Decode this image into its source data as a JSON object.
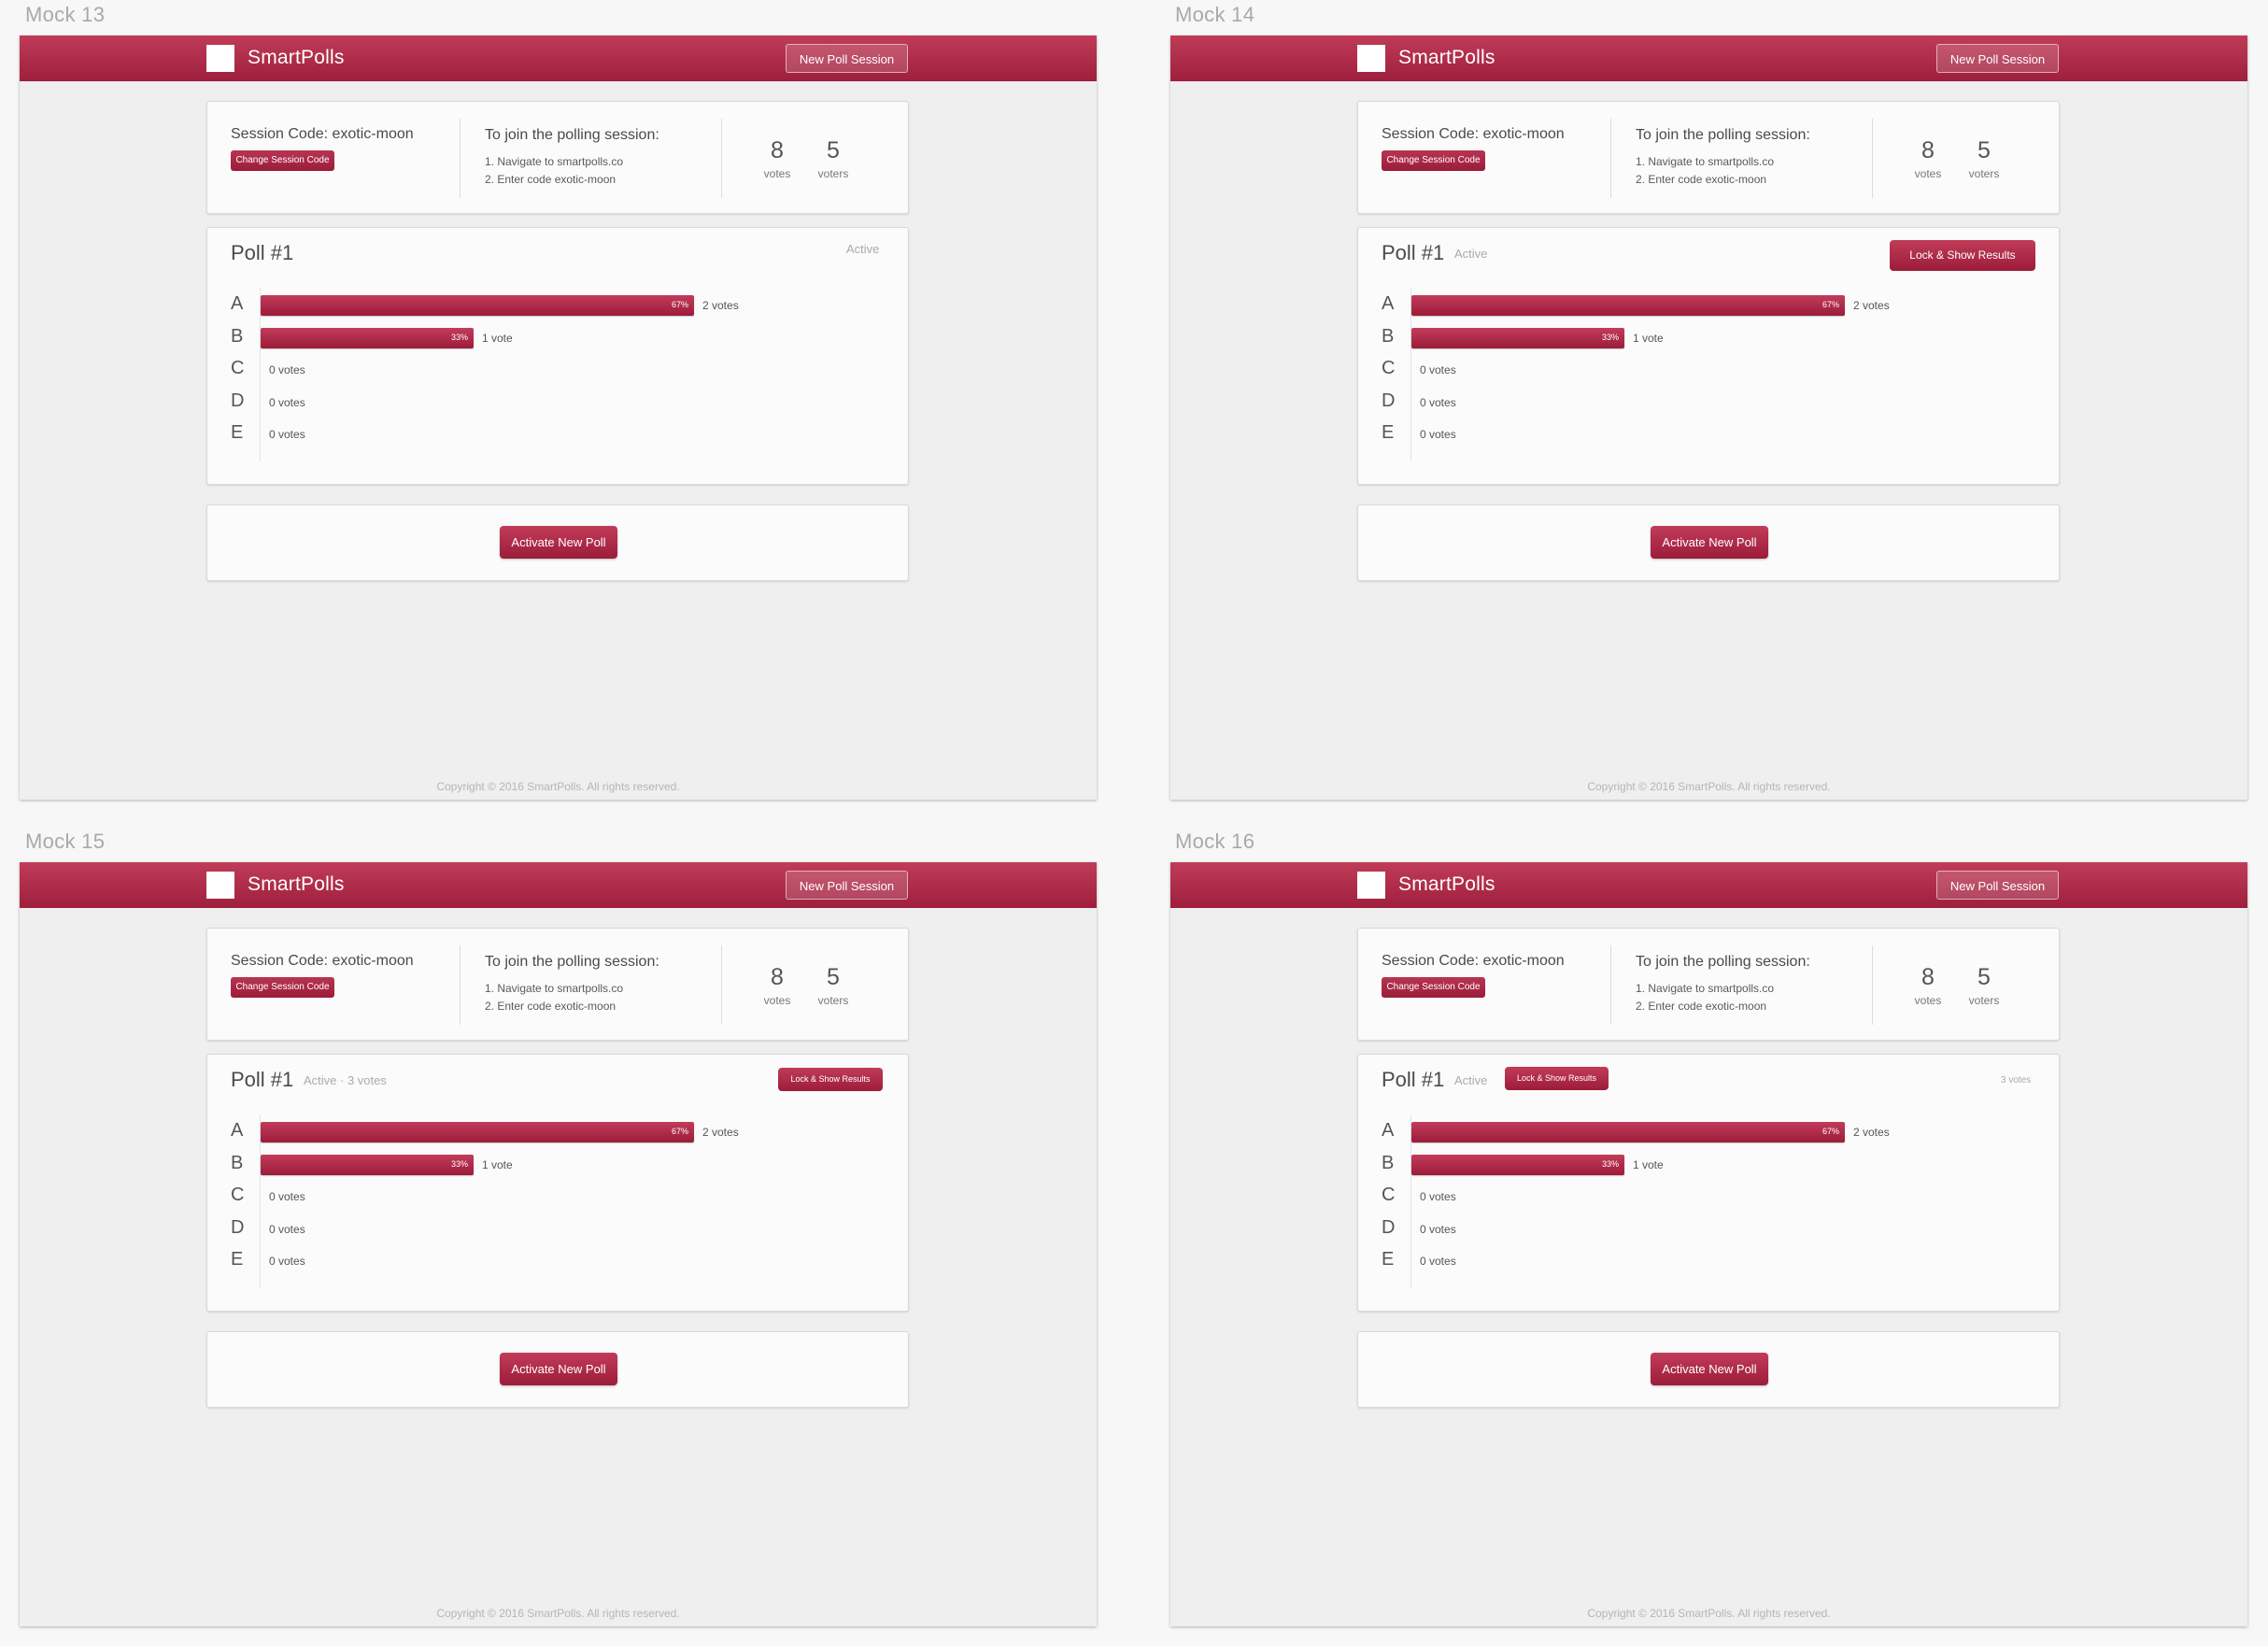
{
  "brand": "SmartPolls",
  "new_session_label": "New Poll Session",
  "session": {
    "code_label": "Session Code: exotic-moon",
    "change_label": "Change Session Code",
    "join_title": "To join the polling session:",
    "step1": "1. Navigate to smartpolls.co",
    "step2": "2. Enter code exotic-moon",
    "votes_count": "8",
    "votes_label": "votes",
    "voters_count": "5",
    "voters_label": "voters"
  },
  "poll": {
    "title": "Poll #1",
    "options": [
      {
        "letter": "A",
        "fraction": 0.67,
        "pct_label": "67%",
        "votes_label": "2 votes"
      },
      {
        "letter": "B",
        "fraction": 0.33,
        "pct_label": "33%",
        "votes_label": "1 vote"
      },
      {
        "letter": "C",
        "fraction": 0,
        "pct_label": "",
        "votes_label": "0 votes"
      },
      {
        "letter": "D",
        "fraction": 0,
        "pct_label": "",
        "votes_label": "0 votes"
      },
      {
        "letter": "E",
        "fraction": 0,
        "pct_label": "",
        "votes_label": "0 votes"
      }
    ]
  },
  "activate_label": "Activate New Poll",
  "footer": "Copyright © 2016 SmartPolls. All rights reserved.",
  "mocks": [
    {
      "label": "Mock 13",
      "status": "Active",
      "lock_label": "",
      "total_votes": ""
    },
    {
      "label": "Mock 14",
      "status": "Active",
      "lock_label": "Lock & Show Results",
      "total_votes": ""
    },
    {
      "label": "Mock 15",
      "status": "Active · 3 votes",
      "lock_label": "Lock & Show Results",
      "total_votes": ""
    },
    {
      "label": "Mock 16",
      "status": "Active",
      "lock_label": "Lock & Show Results",
      "total_votes": "3 votes"
    }
  ],
  "colors": {
    "accent": "#a8264a",
    "background": "#efefef",
    "card": "#fbfbfb"
  }
}
